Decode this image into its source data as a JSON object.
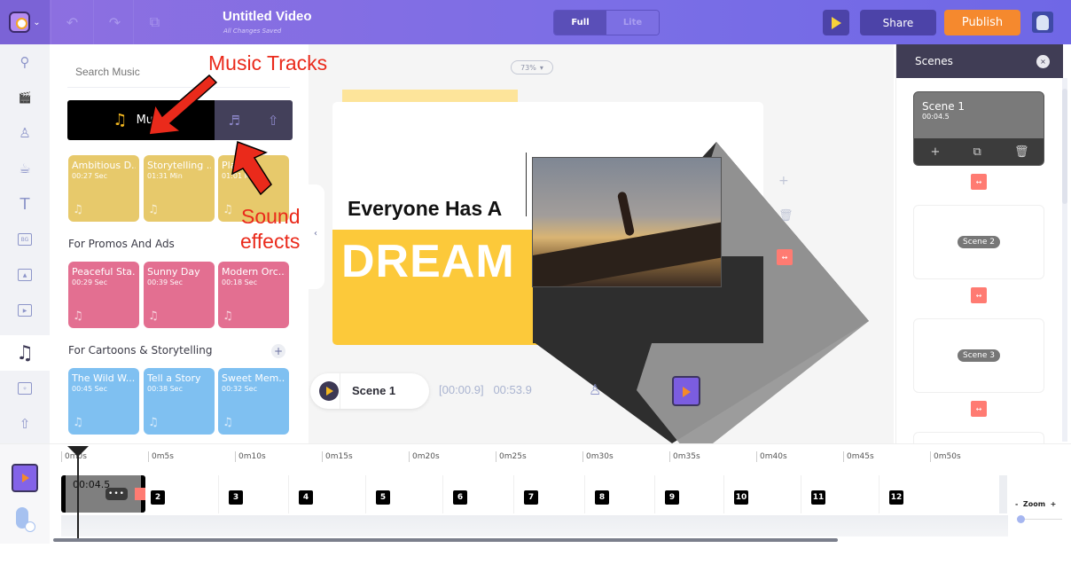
{
  "topbar": {
    "title": "Untitled Video",
    "subtitle": "All Changes Saved",
    "mode_full": "Full",
    "mode_lite": "Lite",
    "share_label": "Share",
    "publish_label": "Publish",
    "icons": [
      "logo-avatar",
      "undo-icon",
      "redo-icon",
      "duplicate-icon"
    ]
  },
  "rail": {
    "items": [
      {
        "name": "search",
        "glyph": "⚲"
      },
      {
        "name": "scenes",
        "glyph": "🎬"
      },
      {
        "name": "characters",
        "glyph": "♙"
      },
      {
        "name": "props",
        "glyph": "☕"
      },
      {
        "name": "text",
        "glyph": "T"
      },
      {
        "name": "backgrounds",
        "glyph": "BG"
      },
      {
        "name": "images",
        "glyph": "▲"
      },
      {
        "name": "videos",
        "glyph": "▶"
      },
      {
        "name": "music",
        "glyph": "♫"
      },
      {
        "name": "effects",
        "glyph": "✧"
      },
      {
        "name": "upload",
        "glyph": "⇧"
      }
    ]
  },
  "music_panel": {
    "search_placeholder": "Search Music",
    "tabs": {
      "music": "Music",
      "music_glyph": "♫",
      "sfx_glyph": "♬",
      "upload_glyph": "⇧"
    },
    "sections": [
      {
        "title": "",
        "color": "#e7c96b",
        "tracks": [
          {
            "title": "Ambitious D...",
            "duration": "00:27 Sec"
          },
          {
            "title": "Storytelling ...",
            "duration": "01:31 Min"
          },
          {
            "title": "Pla...",
            "duration": "01:01 Min"
          }
        ]
      },
      {
        "title": "For Promos And Ads",
        "color": "#e36f91",
        "tracks": [
          {
            "title": "Peaceful Sta...",
            "duration": "00:29 Sec"
          },
          {
            "title": "Sunny Day",
            "duration": "00:39 Sec"
          },
          {
            "title": "Modern Orc...",
            "duration": "00:18 Sec"
          }
        ]
      },
      {
        "title": "For Cartoons & Storytelling",
        "color": "#7fc0f1",
        "tracks": [
          {
            "title": "The Wild W...",
            "duration": "00:45 Sec"
          },
          {
            "title": "Tell a Story",
            "duration": "00:38 Sec"
          },
          {
            "title": "Sweet Mem...",
            "duration": "00:32 Sec"
          }
        ]
      }
    ],
    "add_glyph": "+",
    "note_glyph": "♫",
    "collapse_glyph": "‹"
  },
  "annotations": {
    "music_tracks": "Music Tracks",
    "sound": "Sound",
    "effects": "effects"
  },
  "stage": {
    "zoom_level": "73%",
    "zoom_caret": "▾",
    "headline": "Everyone Has A",
    "big_word": "DREAM",
    "tool_add": "+",
    "tool_delete": "🗑",
    "scene_name": "Scene 1",
    "timecode_start": "[00:00.9]",
    "timecode_end": "00:53.9",
    "char_glyph": "♙"
  },
  "scenes_panel": {
    "title": "Scenes",
    "close_glyph": "×",
    "scenes": [
      {
        "name": "Scene 1",
        "duration": "00:04.5",
        "active": true
      },
      {
        "name": "Scene 2",
        "active": false
      },
      {
        "name": "Scene 3",
        "active": false
      }
    ],
    "action_add": "+",
    "action_copy": "⧉",
    "action_delete": "🗑",
    "transition_glyph": "↔"
  },
  "timeline": {
    "ticks": [
      "0m0s",
      "0m5s",
      "0m10s",
      "0m15s",
      "0m20s",
      "0m25s",
      "0m30s",
      "0m35s",
      "0m40s",
      "0m45s",
      "0m50s"
    ],
    "clip_time": "00:04.5",
    "more_glyph": "•••",
    "scene_numbers": [
      "2",
      "3",
      "4",
      "5",
      "6",
      "7",
      "8",
      "9",
      "10",
      "11",
      "12"
    ],
    "zoom_label": "Zoom",
    "zoom_minus": "-",
    "zoom_plus": "+",
    "zoom_value": 0
  }
}
